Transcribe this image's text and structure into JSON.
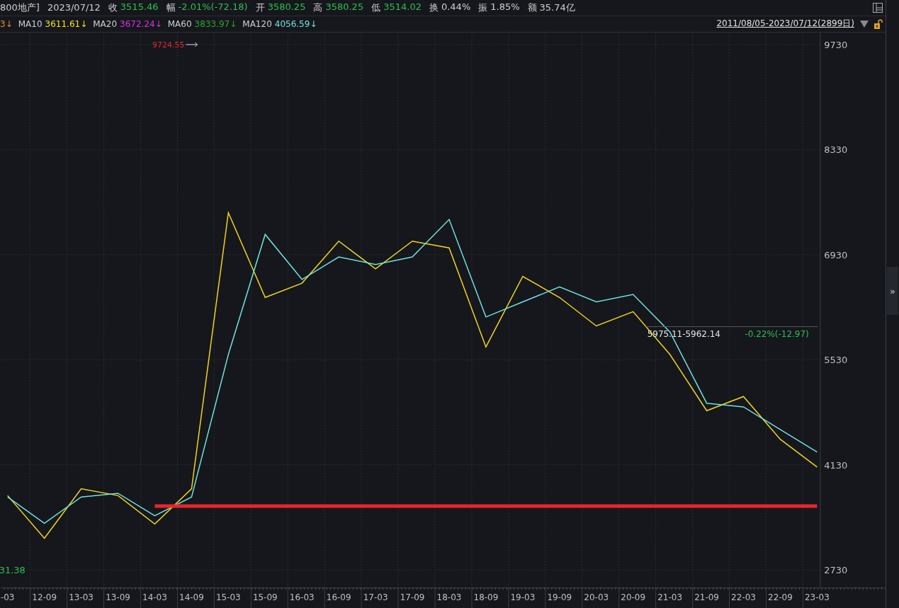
{
  "header": {
    "name": "800地产]",
    "date": "2023/07/12",
    "stats": [
      {
        "label": "收",
        "value": "3515.46",
        "color": "#2fbf4f"
      },
      {
        "label": "幅",
        "value": "-2.01%(-72.18)",
        "color": "#2fbf4f"
      },
      {
        "label": "开",
        "value": "3580.25",
        "color": "#2fbf4f"
      },
      {
        "label": "高",
        "value": "3580.25",
        "color": "#2fbf4f"
      },
      {
        "label": "低",
        "value": "3514.02",
        "color": "#2fbf4f"
      },
      {
        "label": "换",
        "value": "0.44%",
        "color": "#d0d0d0"
      },
      {
        "label": "振",
        "value": "1.85%",
        "color": "#d0d0d0"
      },
      {
        "label": "额",
        "value": "35.74亿",
        "color": "#d0d0d0"
      }
    ]
  },
  "ma_bar": {
    "items": [
      {
        "value": "3↓",
        "color": "#f08c1e"
      },
      {
        "label": "MA10",
        "value": "3611.61↓",
        "color": "#f2e21b"
      },
      {
        "label": "MA20",
        "value": "3672.24↓",
        "color": "#e02ee0"
      },
      {
        "label": "MA60",
        "value": "3833.97↓",
        "color": "#2fa52f"
      },
      {
        "label": "MA120",
        "value": "4056.59↓",
        "color": "#6fe0e0"
      }
    ],
    "date_range": "2011/08/05-2023/07/12(2899日)"
  },
  "chart_data": {
    "type": "line",
    "categories": [
      "-03",
      "12-09",
      "13-03",
      "13-09",
      "14-03",
      "14-09",
      "15-03",
      "15-09",
      "16-03",
      "16-09",
      "17-03",
      "17-09",
      "18-03",
      "18-09",
      "19-03",
      "19-09",
      "20-03",
      "20-09",
      "21-03",
      "21-09",
      "22-03",
      "22-09",
      "23-03"
    ],
    "series": [
      {
        "color": "#f2d41b",
        "values": [
          3720,
          3150,
          3810,
          3720,
          3340,
          3810,
          7490,
          6360,
          6550,
          7110,
          6740,
          7110,
          7020,
          5700,
          6640,
          6360,
          5980,
          6170,
          5600,
          4850,
          5040,
          4470,
          4100
        ]
      },
      {
        "color": "#6fe0e0",
        "values": [
          3700,
          3350,
          3700,
          3750,
          3450,
          3700,
          5600,
          7200,
          6600,
          6900,
          6800,
          6900,
          7400,
          6100,
          6300,
          6500,
          6300,
          6400,
          5900,
          4950,
          4900,
          4600,
          4300
        ]
      },
      {
        "color": "#e8262b",
        "values": [
          null,
          null,
          null,
          null,
          3580,
          3580,
          3580,
          3580,
          3580,
          3580,
          3580,
          3580,
          3580,
          3580,
          3580,
          3580,
          3580,
          3580,
          3580,
          3580,
          3580,
          3580,
          3580
        ]
      }
    ],
    "ylim": [
      2494,
      9890
    ],
    "yticks": [
      2730,
      4130,
      5530,
      6930,
      8330,
      9730
    ],
    "grid": true
  },
  "chart_marks": {
    "max_label": "9724.55",
    "min_label": "31.38",
    "range_readout": "5975.11-5962.14",
    "range_change": "-0.22%(-12.97)"
  },
  "collapse_tab": "»"
}
